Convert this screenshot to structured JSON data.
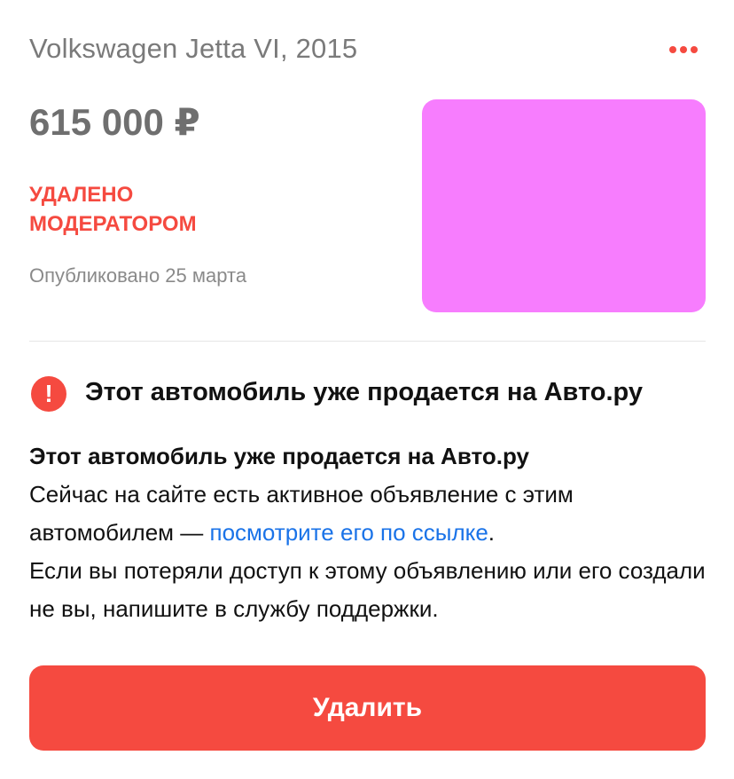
{
  "listing": {
    "title": "Volkswagen Jetta VI, 2015",
    "price": "615 000 ₽",
    "status": "УДАЛЕНО МОДЕРАТОРОМ",
    "published": "Опубликовано 25 марта",
    "menu_icon": "more-dots-icon",
    "photo_color": "#f77dfe"
  },
  "notice": {
    "icon": "exclamation-icon",
    "icon_glyph": "!",
    "title": "Этот автомобиль уже продается на Авто.ру",
    "heading": "Этот автомобиль уже продается на Авто.ру",
    "text_before_link": "Сейчас на сайте есть активное объявление с этим автомобилем — ",
    "link_text": "посмотрите его по ссылке",
    "text_after_link": ".",
    "text_support": "Если вы потеряли доступ к этому объявлению или его создали не вы, напишите в службу поддержки."
  },
  "actions": {
    "delete_label": "Удалить"
  },
  "colors": {
    "accent": "#f54a40",
    "link": "#1a73e8",
    "title_gray": "#7a7a7a"
  }
}
